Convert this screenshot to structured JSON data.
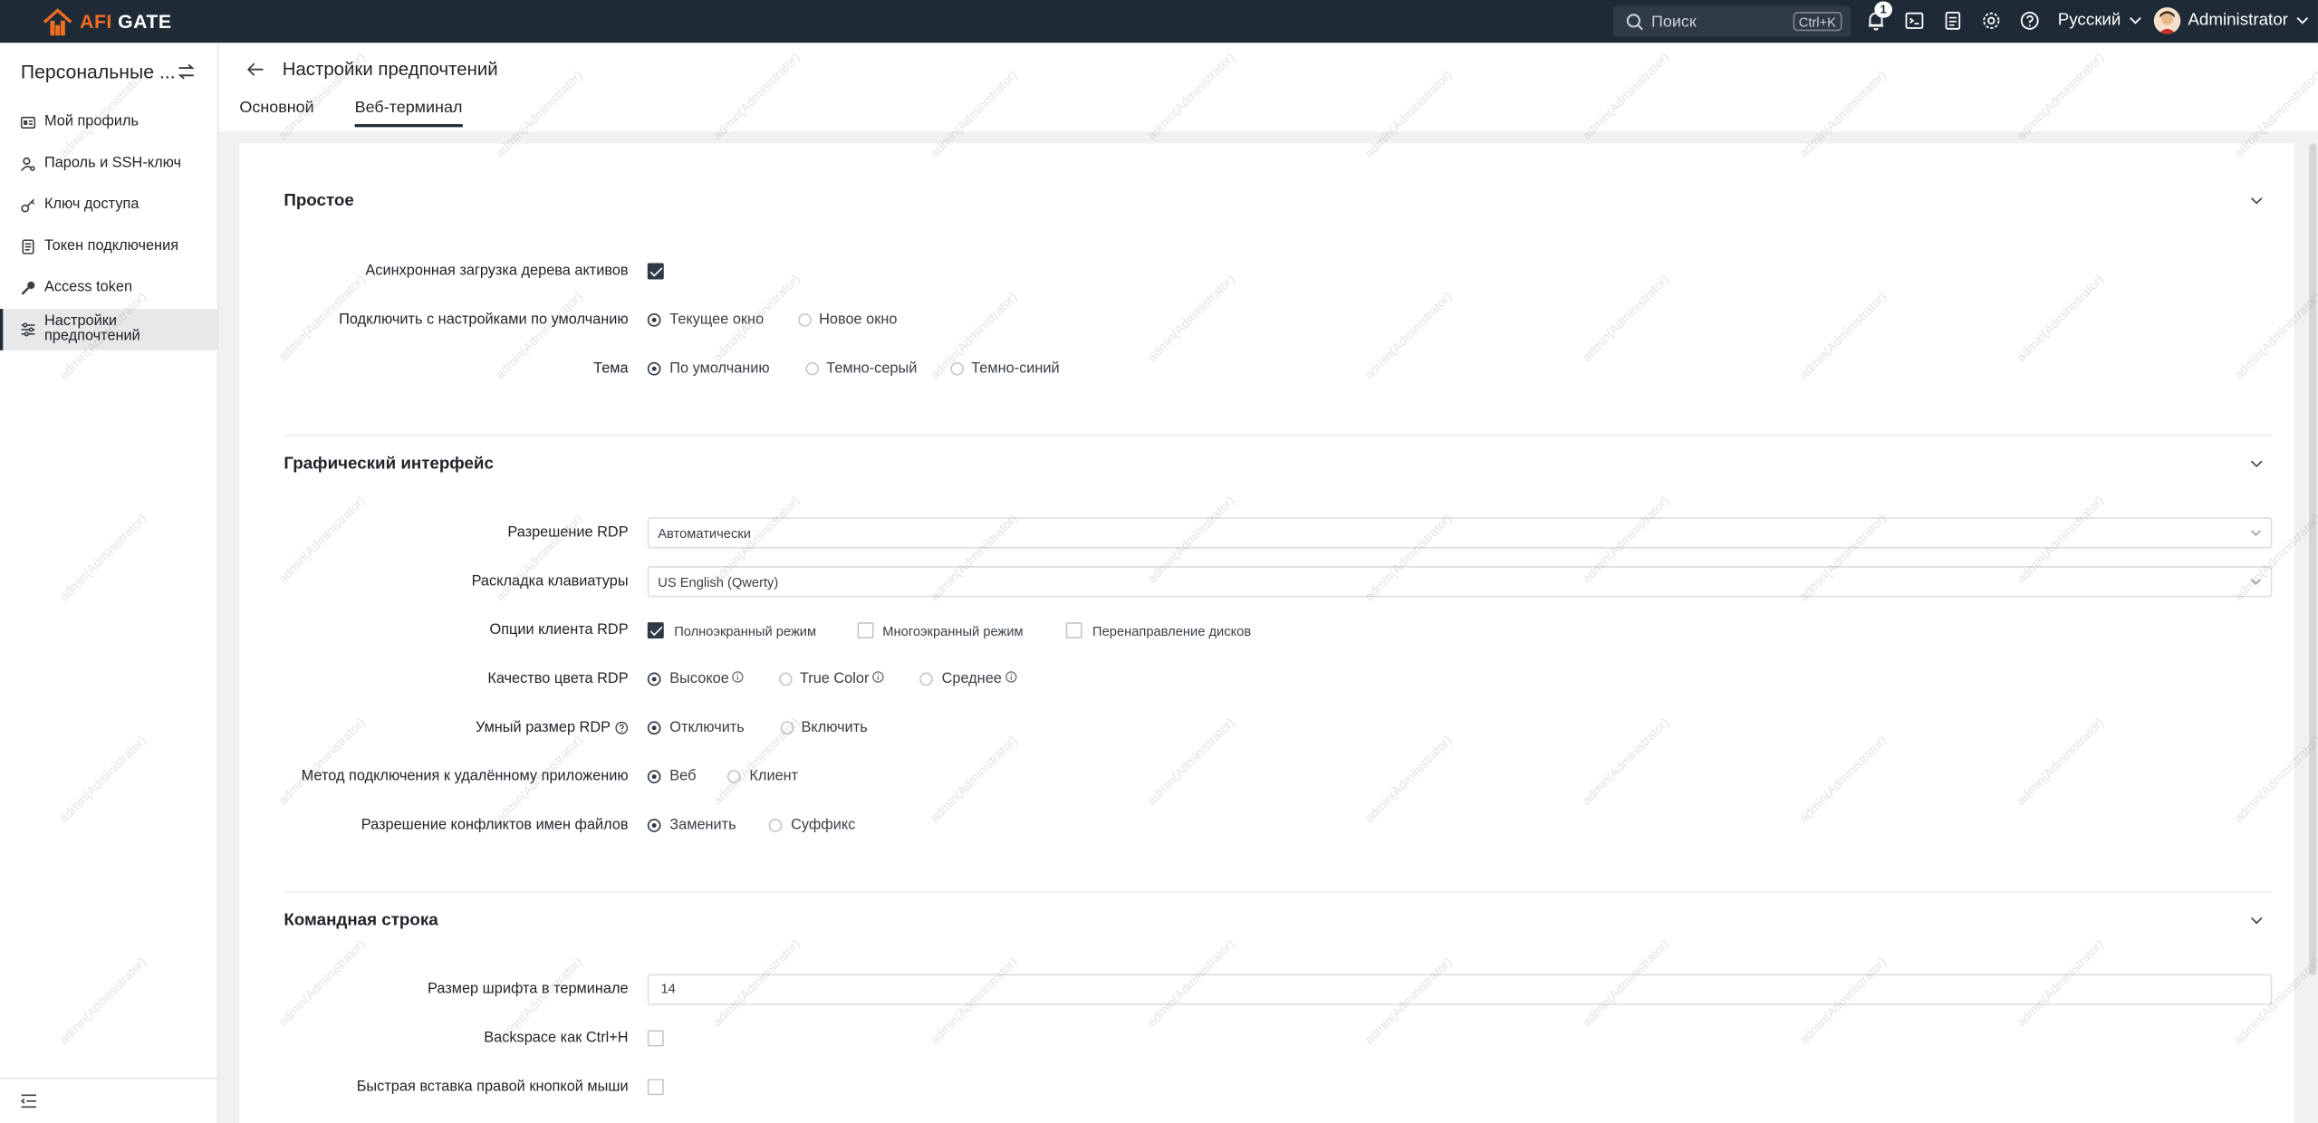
{
  "brand": {
    "prefix": "AFI",
    "name": "GATE"
  },
  "topbar": {
    "search_placeholder": "Поиск",
    "search_shortcut": "Ctrl+K",
    "notification_count": "1",
    "language": "Русский",
    "user_name": "Administrator"
  },
  "sidebar": {
    "title": "Персональные ...",
    "items": [
      {
        "label": "Мой профиль",
        "icon": "id-card-icon"
      },
      {
        "label": "Пароль и SSH-ключ",
        "icon": "user-key-icon"
      },
      {
        "label": "Ключ доступа",
        "icon": "key-icon"
      },
      {
        "label": "Токен подключения",
        "icon": "token-icon"
      },
      {
        "label": "Access token",
        "icon": "key-solid-icon"
      },
      {
        "label": "Настройки предпочтений",
        "icon": "sliders-icon"
      }
    ]
  },
  "page": {
    "title": "Настройки предпочтений",
    "tabs": [
      "Основной",
      "Веб-терминал"
    ],
    "active_tab": "Веб-терминал"
  },
  "sections": {
    "basic": {
      "title": "Простое",
      "async_tree_label": "Асинхронная загрузка дерева активов",
      "async_tree_checked": true,
      "connect_default_label": "Подключить с настройками по умолчанию",
      "connect_default_options": [
        "Текущее окно",
        "Новое окно"
      ],
      "connect_default_selected": "Текущее окно",
      "theme_label": "Тема",
      "theme_options": [
        "По умолчанию",
        "Темно-серый",
        "Темно-синий"
      ],
      "theme_selected": "По умолчанию"
    },
    "gui": {
      "title": "Графический интерфейс",
      "rdp_resolution_label": "Разрешение RDP",
      "rdp_resolution_value": "Автоматически",
      "keyboard_layout_label": "Раскладка клавиатуры",
      "keyboard_layout_value": "US English (Qwerty)",
      "rdp_client_options_label": "Опции клиента RDP",
      "rdp_client_options": [
        {
          "label": "Полноэкранный режим",
          "checked": true
        },
        {
          "label": "Многоэкранный режим",
          "checked": false
        },
        {
          "label": "Перенаправление дисков",
          "checked": false
        }
      ],
      "color_quality_label": "Качество цвета RDP",
      "color_quality_options": [
        "Высокое",
        "True Color",
        "Среднее"
      ],
      "color_quality_selected": "Высокое",
      "smart_size_label": "Умный размер RDP",
      "smart_size_options": [
        "Отключить",
        "Включить"
      ],
      "smart_size_selected": "Отключить",
      "remote_app_label": "Метод подключения к удалённому приложению",
      "remote_app_options": [
        "Веб",
        "Клиент"
      ],
      "remote_app_selected": "Веб",
      "file_conflict_label": "Разрешение конфликтов имен файлов",
      "file_conflict_options": [
        "Заменить",
        "Суффикс"
      ],
      "file_conflict_selected": "Заменить"
    },
    "cli": {
      "title": "Командная строка",
      "font_size_label": "Размер шрифта в терминале",
      "font_size_value": "14",
      "backspace_label": "Backspace как Ctrl+H",
      "backspace_checked": false,
      "right_click_paste_label": "Быстрая вставка правой кнопкой мыши",
      "right_click_paste_checked": false
    }
  },
  "watermark_text": "admin(Administrator)",
  "colors": {
    "topbar": "#1f2a37",
    "brand_accent": "#f26f21",
    "primary": "#2f3a47"
  }
}
